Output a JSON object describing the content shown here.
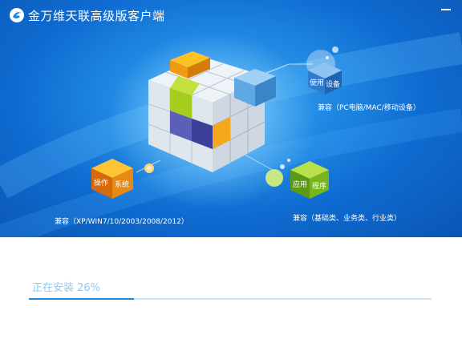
{
  "window": {
    "title": "金万维天联高级版客户端"
  },
  "banner": {
    "cubes": {
      "system": {
        "label_top": "操作",
        "label_side": "系统",
        "caption": "兼容（XP/WIN7/10/2003/2008/2012）"
      },
      "device": {
        "label_top": "使用",
        "label_side": "设备",
        "caption": "兼容（PC电脑/MAC/移动设备）"
      },
      "application": {
        "label_top": "应用",
        "label_side": "程序",
        "caption": "兼容（基础类、业务类、行业类）"
      }
    }
  },
  "install": {
    "status_text": "正在安装 26%",
    "progress": 0.26
  },
  "colors": {
    "banner_blue": "#1e86e2",
    "progress_fill": "#1a8ad8",
    "progress_track": "#c8e4f5",
    "status_text": "#8fcaf0"
  }
}
